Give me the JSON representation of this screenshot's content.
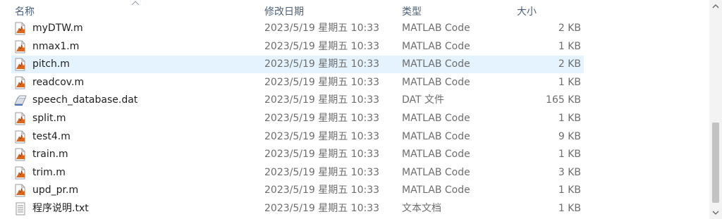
{
  "header": {
    "name": "名称",
    "date": "修改日期",
    "type": "类型",
    "size": "大小"
  },
  "files": [
    {
      "name": "myDTW.m",
      "date": "2023/5/19 星期五 10:33",
      "type": "MATLAB Code",
      "size": "2 KB",
      "icon": "matlab-file-icon"
    },
    {
      "name": "nmax1.m",
      "date": "2023/5/19 星期五 10:33",
      "type": "MATLAB Code",
      "size": "1 KB",
      "icon": "matlab-file-icon"
    },
    {
      "name": "pitch.m",
      "date": "2023/5/19 星期五 10:33",
      "type": "MATLAB Code",
      "size": "2 KB",
      "icon": "matlab-file-icon"
    },
    {
      "name": "readcov.m",
      "date": "2023/5/19 星期五 10:33",
      "type": "MATLAB Code",
      "size": "1 KB",
      "icon": "matlab-file-icon"
    },
    {
      "name": "speech_database.dat",
      "date": "2023/5/19 星期五 10:33",
      "type": "DAT 文件",
      "size": "165 KB",
      "icon": "dat-file-icon"
    },
    {
      "name": "split.m",
      "date": "2023/5/19 星期五 10:33",
      "type": "MATLAB Code",
      "size": "1 KB",
      "icon": "matlab-file-icon"
    },
    {
      "name": "test4.m",
      "date": "2023/5/19 星期五 10:33",
      "type": "MATLAB Code",
      "size": "9 KB",
      "icon": "matlab-file-icon"
    },
    {
      "name": "train.m",
      "date": "2023/5/19 星期五 10:33",
      "type": "MATLAB Code",
      "size": "1 KB",
      "icon": "matlab-file-icon"
    },
    {
      "name": "trim.m",
      "date": "2023/5/19 星期五 10:33",
      "type": "MATLAB Code",
      "size": "3 KB",
      "icon": "matlab-file-icon"
    },
    {
      "name": "upd_pr.m",
      "date": "2023/5/19 星期五 10:33",
      "type": "MATLAB Code",
      "size": "1 KB",
      "icon": "matlab-file-icon"
    },
    {
      "name": "程序说明.txt",
      "date": "2023/5/19 星期五 10:33",
      "type": "文本文档",
      "size": "1 KB",
      "icon": "text-file-icon"
    }
  ],
  "selected_index": 2,
  "colors": {
    "header_text": "#4c607a",
    "selected_row": "#e5f3ff",
    "muted_text": "#6d6d6d"
  }
}
